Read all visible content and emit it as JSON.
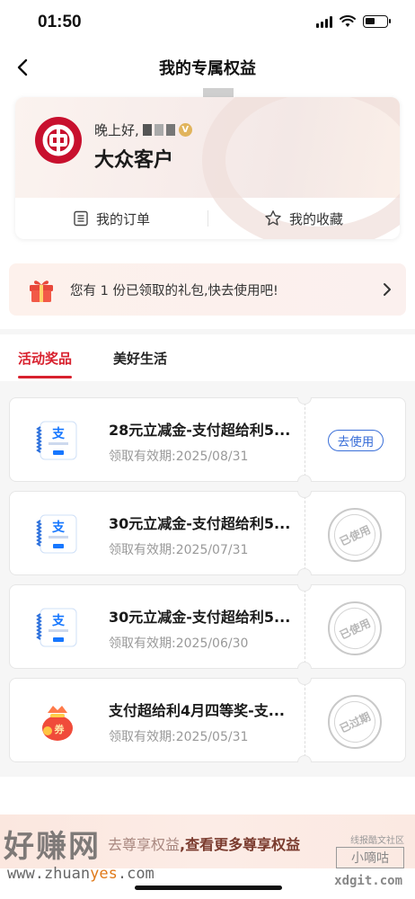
{
  "status_bar": {
    "time": "01:50"
  },
  "header": {
    "title": "我的专属权益"
  },
  "profile": {
    "greeting": "晚上好,",
    "badge": "V",
    "customer_name": "大众客户",
    "my_orders": "我的订单",
    "my_favorites": "我的收藏"
  },
  "gift_banner": {
    "text": "您有 1 份已领取的礼包,快去使用吧!"
  },
  "tabs": [
    {
      "label": "活动奖品",
      "active": true
    },
    {
      "label": "美好生活",
      "active": false
    }
  ],
  "coupons": [
    {
      "title": "28元立减金-支付超给利5...",
      "validity": "领取有效期:2025/08/31",
      "action": "去使用",
      "state": "usable",
      "icon": "alipay-voucher-icon"
    },
    {
      "title": "30元立减金-支付超给利5...",
      "validity": "领取有效期:2025/07/31",
      "action": "已使用",
      "state": "used",
      "icon": "alipay-voucher-icon"
    },
    {
      "title": "30元立减金-支付超给利5...",
      "validity": "领取有效期:2025/06/30",
      "action": "已使用",
      "state": "used",
      "icon": "alipay-voucher-icon"
    },
    {
      "title": "支付超给利4月四等奖-支...",
      "validity": "领取有效期:2025/05/31",
      "action": "已过期",
      "state": "expired",
      "icon": "red-coupon-bag-icon",
      "bag_label": "券"
    }
  ],
  "bottom": {
    "faded": "去尊享权益",
    "link": ",查看更多尊享权益"
  },
  "watermark": {
    "brand": "好赚网",
    "url_prefix": "www.zhuan",
    "url_highlight": "yes",
    "url_suffix": ".com",
    "right_top": "线报酷文社区",
    "right_box": "小嘀咕",
    "right_domain": "xdgit.com"
  },
  "colors": {
    "accent": "#d8212e",
    "link_blue": "#3a6fd8",
    "bank_red": "#c8102e",
    "gold": "#e1b45c"
  }
}
